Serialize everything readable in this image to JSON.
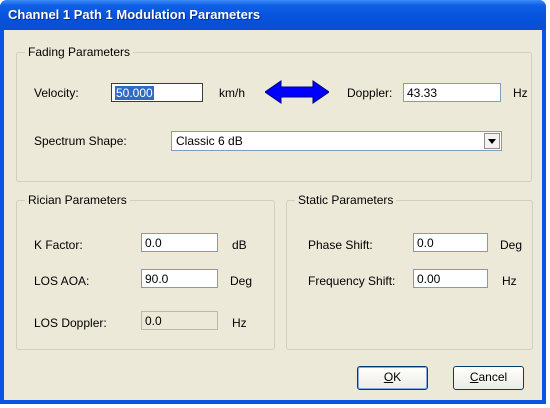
{
  "window": {
    "title": "Channel 1 Path 1 Modulation Parameters"
  },
  "fading": {
    "legend": "Fading Parameters",
    "velocity_label": "Velocity:",
    "velocity_value": "50.000",
    "velocity_unit": "km/h",
    "doppler_label": "Doppler:",
    "doppler_value": "43.33",
    "doppler_unit": "Hz",
    "spectrum_label": "Spectrum Shape:",
    "spectrum_value": "Classic 6 dB",
    "arrow_icon": "double-arrow-icon",
    "arrow_color": "#0000ff"
  },
  "rician": {
    "legend": "Rician Parameters",
    "k_label": "K Factor:",
    "k_value": "0.0",
    "k_unit": "dB",
    "aoa_label": "LOS AOA:",
    "aoa_value": "90.0",
    "aoa_unit": "Deg",
    "los_doppler_label": "LOS Doppler:",
    "los_doppler_value": "0.0",
    "los_doppler_unit": "Hz"
  },
  "static": {
    "legend": "Static Parameters",
    "phase_label": "Phase Shift:",
    "phase_value": "0.0",
    "phase_unit": "Deg",
    "freq_label": "Frequency Shift:",
    "freq_value": "0.00",
    "freq_unit": "Hz"
  },
  "buttons": {
    "ok_accel": "O",
    "ok_rest": "K",
    "cancel_accel": "C",
    "cancel_rest": "ancel"
  },
  "colors": {
    "titlebar": "#0552dc",
    "client": "#ece9d8"
  }
}
